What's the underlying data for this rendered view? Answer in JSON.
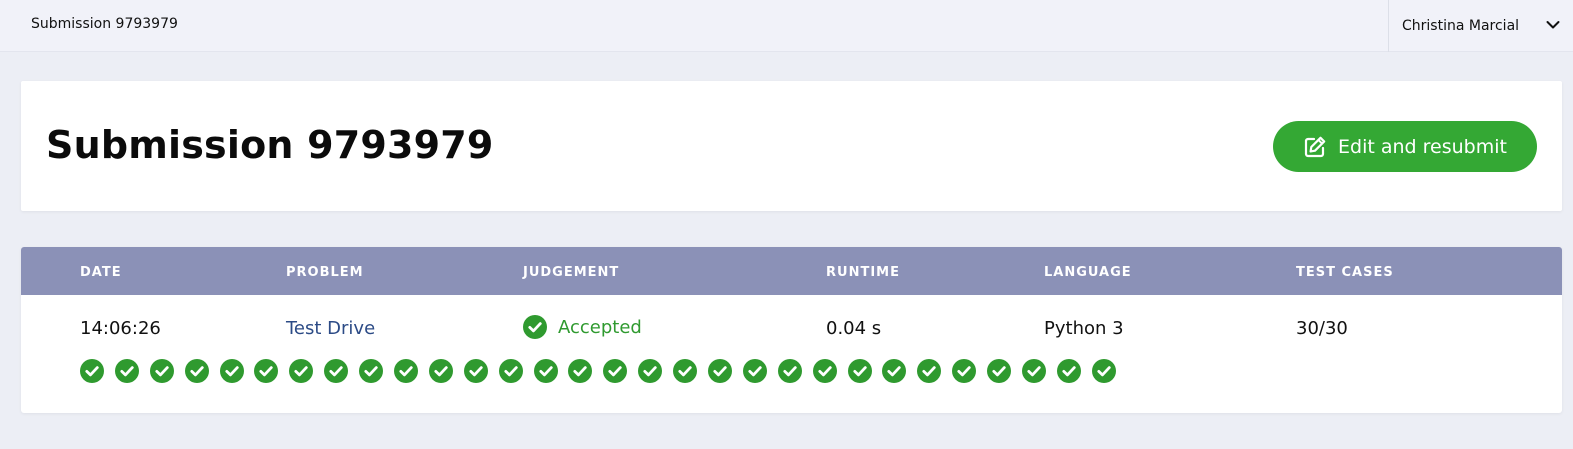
{
  "topbar": {
    "title": "Submission 9793979",
    "user_name": "Christina Marcial",
    "user_menu_icon": "chevron-down-icon"
  },
  "header": {
    "title": "Submission 9793979",
    "resubmit_label": "Edit and resubmit",
    "resubmit_icon": "edit-icon",
    "resubmit_color": "#34a834"
  },
  "table": {
    "columns": [
      "DATE",
      "PROBLEM",
      "JUDGEMENT",
      "RUNTIME",
      "LANGUAGE",
      "TEST CASES"
    ],
    "header_color": "#8b91b7",
    "row": {
      "date": "14:06:26",
      "problem": "Test Drive",
      "judgement": "Accepted",
      "judgement_icon": "check-circle-icon",
      "judgement_color": "#2f9a2f",
      "runtime": "0.04 s",
      "language": "Python 3",
      "test_cases": "30/30"
    },
    "test_case_results": [
      "passed",
      "passed",
      "passed",
      "passed",
      "passed",
      "passed",
      "passed",
      "passed",
      "passed",
      "passed",
      "passed",
      "passed",
      "passed",
      "passed",
      "passed",
      "passed",
      "passed",
      "passed",
      "passed",
      "passed",
      "passed",
      "passed",
      "passed",
      "passed",
      "passed",
      "passed",
      "passed",
      "passed",
      "passed",
      "passed"
    ]
  }
}
